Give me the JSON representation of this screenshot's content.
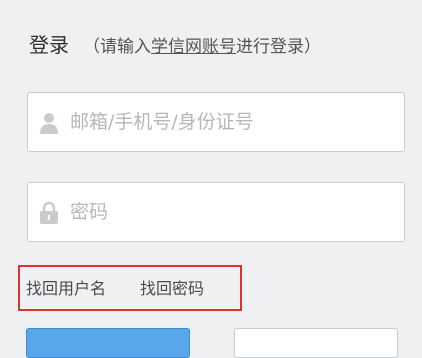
{
  "header": {
    "title": "登录",
    "hint_open": "（请输入",
    "hint_link": "学信网账号",
    "hint_close": "进行登录）"
  },
  "form": {
    "username_placeholder": "邮箱/手机号/身份证号",
    "username_icon": "user-icon",
    "password_placeholder": "密码",
    "password_icon": "lock-icon"
  },
  "links": {
    "find_username": "找回用户名",
    "find_password": "找回密码",
    "highlight_color": "#e0322f"
  },
  "colors": {
    "background": "#eef0f1",
    "login_button": "#5aa6ea"
  }
}
